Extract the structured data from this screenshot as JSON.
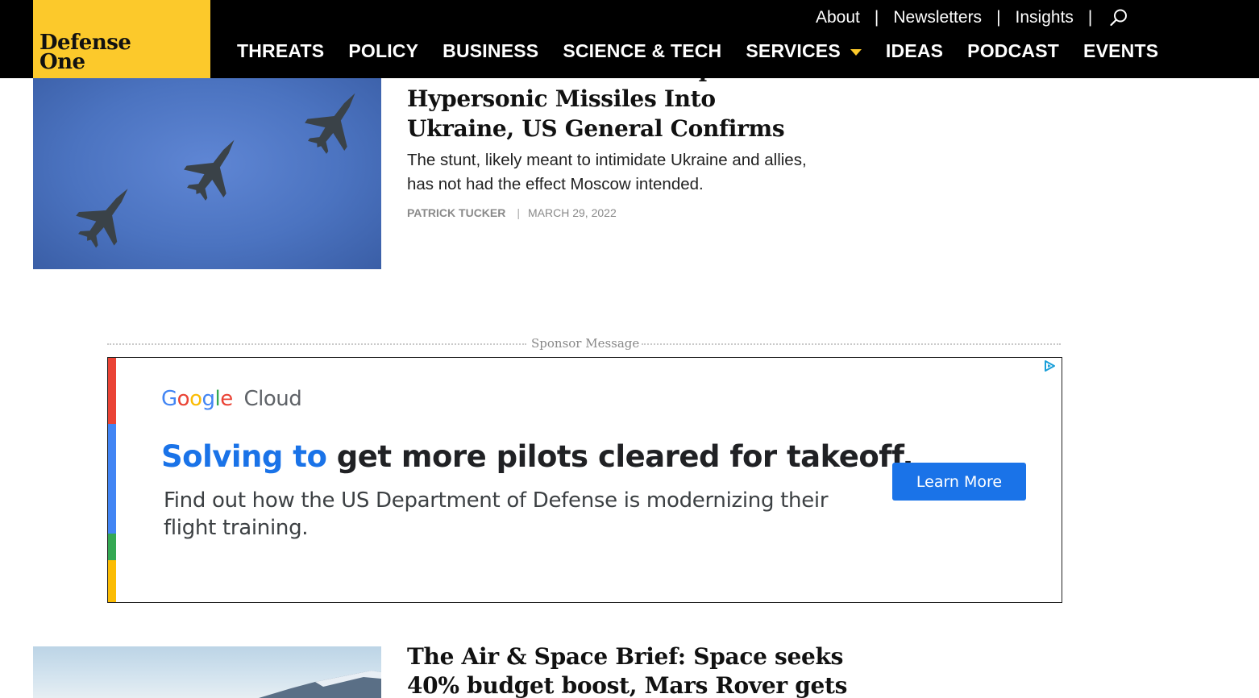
{
  "header": {
    "logo_line1": "Defense",
    "logo_line2": "One",
    "util_links": [
      "About",
      "Newsletters",
      "Insights"
    ],
    "util_separator": "|",
    "nav": [
      "THREATS",
      "POLICY",
      "BUSINESS",
      "SCIENCE & TECH",
      "SERVICES",
      "IDEAS",
      "PODCAST",
      "EVENTS"
    ],
    "brand_color": "#fcc92b"
  },
  "article1": {
    "headline_cut": "Russia Has Fired Multiple",
    "headline": "Hypersonic Missiles Into Ukraine, US General Confirms",
    "dek": "The stunt, likely meant to intimidate Ukraine and allies, has not had the effect Moscow intended.",
    "author": "PATRICK TUCKER",
    "separator": "|",
    "date": "MARCH 29, 2022"
  },
  "sponsor": {
    "label": "Sponsor Message",
    "ad": {
      "brand": "Google",
      "brand_suffix": "Cloud",
      "headline_highlight": "Solving to",
      "headline_rest": " get more pilots cleared for takeoff.",
      "body": "Find out how the US Department of Defense is modernizing their flight training.",
      "cta": "Learn More",
      "accent": "#1a73e8"
    }
  },
  "article2": {
    "headline": "The Air & Space Brief: Space seeks 40% budget boost, Mars Rover gets"
  }
}
